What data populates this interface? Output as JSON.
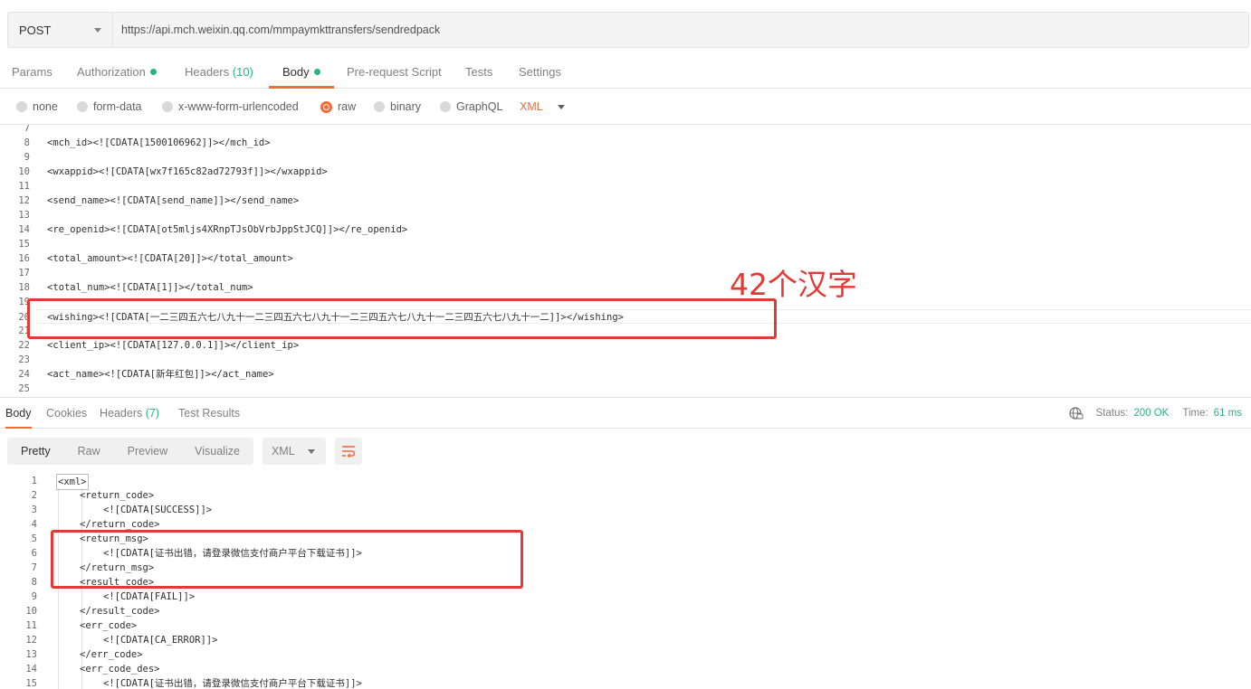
{
  "request": {
    "method": "POST",
    "url": "https://api.mch.weixin.qq.com/mmpaymkttransfers/sendredpack"
  },
  "req_tabs": {
    "params": "Params",
    "authorization": "Authorization",
    "headers": "Headers",
    "headers_count": "(10)",
    "body": "Body",
    "prerequest": "Pre-request Script",
    "tests": "Tests",
    "settings": "Settings"
  },
  "body_types": {
    "none": "none",
    "form_data": "form-data",
    "urlencoded": "x-www-form-urlencoded",
    "raw": "raw",
    "binary": "binary",
    "graphql": "GraphQL",
    "format": "XML"
  },
  "editor_lines": [
    {
      "n": "7",
      "code": ""
    },
    {
      "n": "8",
      "code": "<mch_id><![CDATA[1500106962]]></mch_id>"
    },
    {
      "n": "9",
      "code": ""
    },
    {
      "n": "10",
      "code": "<wxappid><![CDATA[wx7f165c82ad72793f]]></wxappid>"
    },
    {
      "n": "11",
      "code": ""
    },
    {
      "n": "12",
      "code": "<send_name><![CDATA[send_name]]></send_name>"
    },
    {
      "n": "13",
      "code": ""
    },
    {
      "n": "14",
      "code": "<re_openid><![CDATA[ot5mljs4XRnpTJsObVrbJppStJCQ]]></re_openid>"
    },
    {
      "n": "15",
      "code": ""
    },
    {
      "n": "16",
      "code": "<total_amount><![CDATA[20]]></total_amount>"
    },
    {
      "n": "17",
      "code": ""
    },
    {
      "n": "18",
      "code": "<total_num><![CDATA[1]]></total_num>"
    },
    {
      "n": "19",
      "code": ""
    },
    {
      "n": "20",
      "code": "<wishing><![CDATA[一二三四五六七八九十一二三四五六七八九十一二三四五六七八九十一二三四五六七八九十一二]]></wishing>"
    },
    {
      "n": "21",
      "code": ""
    },
    {
      "n": "22",
      "code": "<client_ip><![CDATA[127.0.0.1]]></client_ip>"
    },
    {
      "n": "23",
      "code": ""
    },
    {
      "n": "24",
      "code": "<act_name><![CDATA[新年红包]]></act_name>"
    },
    {
      "n": "25",
      "code": ""
    }
  ],
  "annotation": "42个汉字",
  "resp_tabs": {
    "body": "Body",
    "cookies": "Cookies",
    "headers": "Headers",
    "headers_count": "(7)",
    "test_results": "Test Results"
  },
  "status": {
    "status_label": "Status:",
    "status_value": "200 OK",
    "time_label": "Time:",
    "time_value": "61 ms"
  },
  "resp_view": {
    "pretty": "Pretty",
    "raw": "Raw",
    "preview": "Preview",
    "visualize": "Visualize",
    "format": "XML"
  },
  "response_lines": [
    {
      "n": "1",
      "indent": 0,
      "code": "<xml>"
    },
    {
      "n": "2",
      "indent": 1,
      "code": "<return_code>"
    },
    {
      "n": "3",
      "indent": 2,
      "code": "<![CDATA[SUCCESS]]>"
    },
    {
      "n": "4",
      "indent": 1,
      "code": "</return_code>"
    },
    {
      "n": "5",
      "indent": 1,
      "code": "<return_msg>"
    },
    {
      "n": "6",
      "indent": 2,
      "code": "<![CDATA[证书出错，请登录微信支付商户平台下载证书]]>"
    },
    {
      "n": "7",
      "indent": 1,
      "code": "</return_msg>"
    },
    {
      "n": "8",
      "indent": 1,
      "code": "<result_code>"
    },
    {
      "n": "9",
      "indent": 2,
      "code": "<![CDATA[FAIL]]>"
    },
    {
      "n": "10",
      "indent": 1,
      "code": "</result_code>"
    },
    {
      "n": "11",
      "indent": 1,
      "code": "<err_code>"
    },
    {
      "n": "12",
      "indent": 2,
      "code": "<![CDATA[CA_ERROR]]>"
    },
    {
      "n": "13",
      "indent": 1,
      "code": "</err_code>"
    },
    {
      "n": "14",
      "indent": 1,
      "code": "<err_code_des>"
    },
    {
      "n": "15",
      "indent": 2,
      "code": "<![CDATA[证书出错，请登录微信支付商户平台下载证书]]>"
    }
  ]
}
